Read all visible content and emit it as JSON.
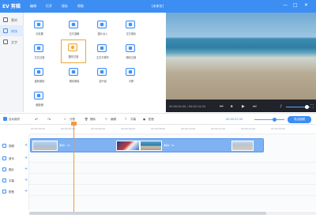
{
  "app": {
    "logo": "EV 剪辑",
    "file_title": "[未命名]"
  },
  "menu": [
    "编辑",
    "打开",
    "保存",
    "帮助"
  ],
  "window_controls": [
    "—",
    "□",
    "✕"
  ],
  "sidebar": {
    "items": [
      {
        "label": "素材",
        "active": false
      },
      {
        "label": "转场",
        "active": true
      },
      {
        "label": "文字",
        "active": false
      }
    ]
  },
  "effects": {
    "tiles": [
      {
        "label": "无效果",
        "icon": "blank-icon",
        "selected": false
      },
      {
        "label": "交叉溶解",
        "icon": "cross-icon",
        "selected": false
      },
      {
        "label": "图片淡入",
        "icon": "fade-in-icon",
        "selected": false
      },
      {
        "label": "交叉擦化",
        "icon": "cross-wipe-icon",
        "selected": false
      },
      {
        "label": "左右过渡",
        "icon": "lr-icon",
        "selected": false
      },
      {
        "label": "圆形过渡",
        "icon": "circle-icon",
        "selected": true
      },
      {
        "label": "左右平移开",
        "icon": "slide-icon",
        "selected": false
      },
      {
        "label": "随机过渡",
        "icon": "random-icon",
        "selected": false
      },
      {
        "label": "旋转擦除",
        "icon": "rotate-icon",
        "selected": false
      },
      {
        "label": "横向擦除",
        "icon": "horizontal-icon",
        "selected": false
      },
      {
        "label": "百叶窗",
        "icon": "blinds-icon",
        "selected": false
      },
      {
        "label": "平移",
        "icon": "pan-icon",
        "selected": false
      },
      {
        "label": "缩放缩",
        "icon": "zoom-icon",
        "selected": false
      }
    ]
  },
  "preview": {
    "timecode": "00:00:00.00 / 00:00:14.04",
    "buttons": [
      "⏮",
      "⏹",
      "▶",
      "⏭"
    ],
    "fullscreen": "⛶"
  },
  "toolbar": {
    "items": [
      "自动吸附",
      "分割",
      "删除",
      "编辑",
      "字幕",
      "配音"
    ],
    "zoom_time": "00:00:02.00",
    "export_label": "导出视频"
  },
  "timeline": {
    "ruler_ticks": [
      "00:00:00.00",
      "00:00:02.00",
      "00:00:04.00",
      "00:00:06.00",
      "00:00:08.00",
      "00:00:10.00",
      "00:00:12.00",
      "00:00:14.00",
      "00:00:16.00"
    ],
    "tracks": [
      {
        "label": "视频",
        "icon": "video-icon"
      },
      {
        "label": "音乐",
        "icon": "music-icon"
      },
      {
        "label": "图片",
        "icon": "image-icon"
      },
      {
        "label": "字幕",
        "icon": "subtitle-icon"
      },
      {
        "label": "配音",
        "icon": "mic-icon"
      }
    ],
    "clips": [
      {
        "label": "素材1",
        "duration": "4s"
      },
      {
        "label": "素材2",
        "duration": "5s"
      },
      {
        "label": "素材3",
        "duration": "4s"
      }
    ]
  },
  "colors": {
    "accent": "#3d8ef3",
    "playhead": "#f09a3e",
    "selected_tile": "#e8a93a"
  }
}
